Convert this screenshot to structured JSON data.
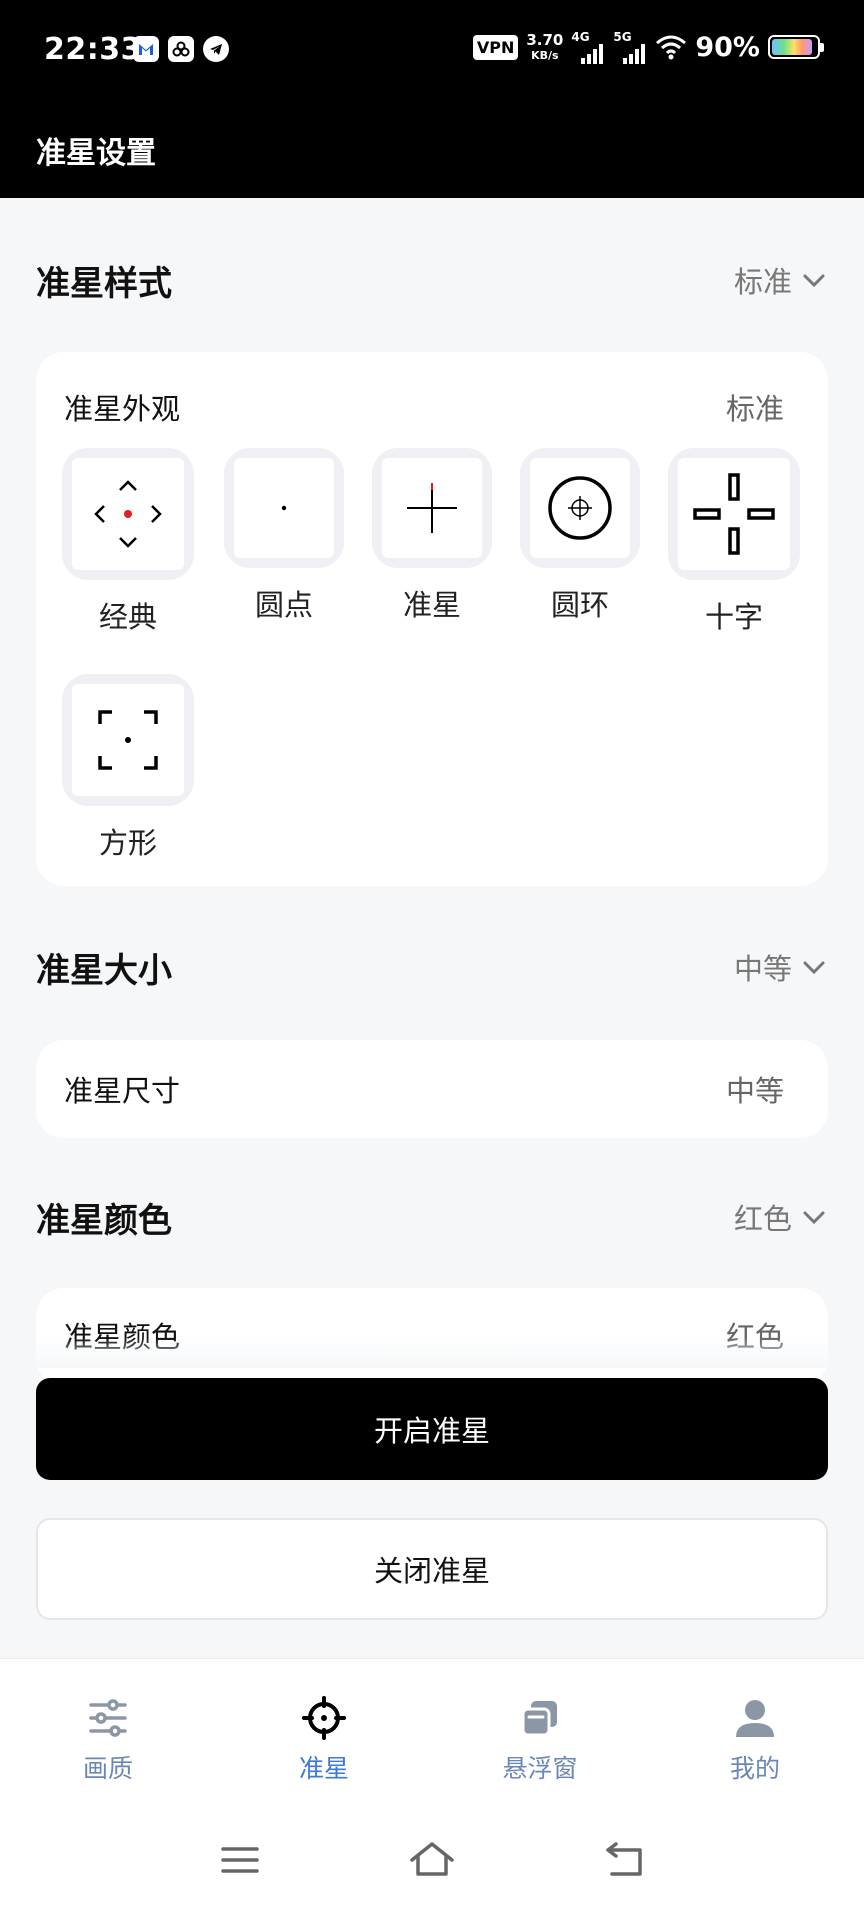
{
  "status_bar": {
    "time": "22:33",
    "vpn": "VPN",
    "speed_value": "3.70",
    "speed_unit": "KB/s",
    "net1": "4G",
    "net2": "5G",
    "battery_pct": "90%",
    "battery_level": 0.9,
    "app_icons": [
      "gmail-icon",
      "community-icon",
      "telegram-icon"
    ]
  },
  "header": {
    "title": "准星设置"
  },
  "style_section": {
    "title": "准星样式",
    "value": "标准",
    "card_label": "准星外观",
    "card_value": "标准",
    "items": [
      {
        "label": "经典",
        "icon": "classic-reticle-icon"
      },
      {
        "label": "圆点",
        "icon": "dot-reticle-icon"
      },
      {
        "label": "准星",
        "icon": "crosshair-reticle-icon"
      },
      {
        "label": "圆环",
        "icon": "ring-reticle-icon"
      },
      {
        "label": "十字",
        "icon": "cross-reticle-icon"
      },
      {
        "label": "方形",
        "icon": "square-reticle-icon"
      }
    ]
  },
  "size_section": {
    "title": "准星大小",
    "value": "中等",
    "row_label": "准星尺寸",
    "row_value": "中等"
  },
  "color_section": {
    "title": "准星颜色",
    "value": "红色",
    "row_label": "准星颜色",
    "row_value": "红色",
    "accent": "#e02020"
  },
  "buttons": {
    "enable": "开启准星",
    "disable": "关闭准星"
  },
  "bottom_nav": {
    "items": [
      {
        "label": "画质",
        "icon": "sliders-icon"
      },
      {
        "label": "准星",
        "icon": "crosshair-icon",
        "active": true
      },
      {
        "label": "悬浮窗",
        "icon": "floating-window-icon"
      },
      {
        "label": "我的",
        "icon": "profile-icon"
      }
    ],
    "active_color": "#3d7ad6",
    "inactive_color": "#6b87b5"
  },
  "system_nav": [
    "menu-icon",
    "home-icon",
    "back-icon"
  ]
}
